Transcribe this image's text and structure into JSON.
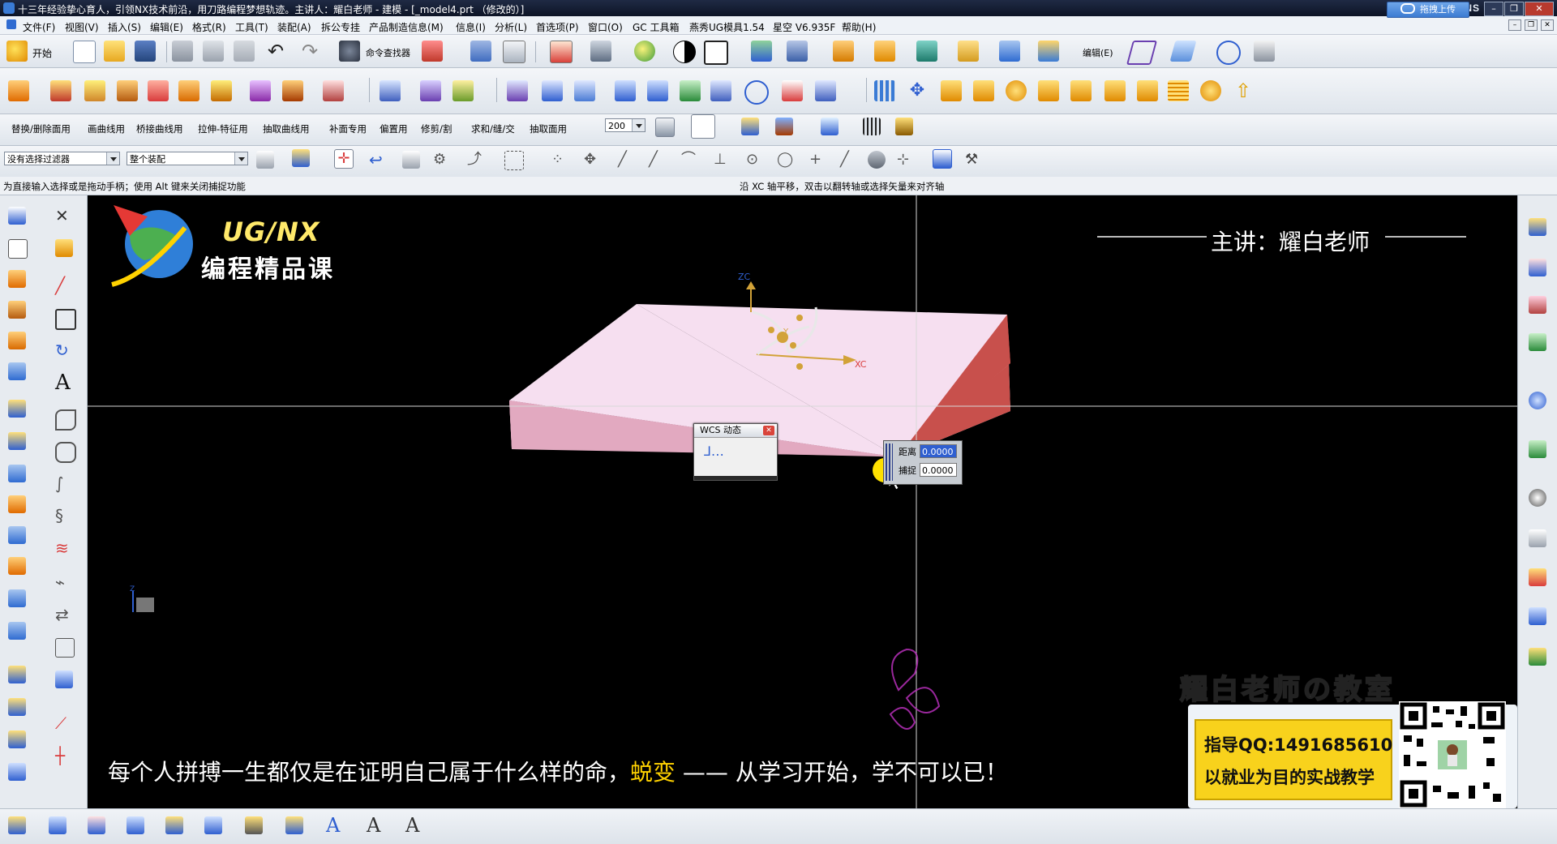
{
  "window": {
    "title": "十三年经验挚心育人，引领NX技术前沿，用刀路编程梦想轨迹。主讲人：耀白老师 - 建模 - [_model4.prt （修改的）]",
    "brand": "SIEMENS",
    "upload_label": "拖拽上传"
  },
  "menu": [
    "文件(F)",
    "视图(V)",
    "插入(S)",
    "编辑(E)",
    "格式(R)",
    "工具(T)",
    "装配(A)",
    "拆公专挂",
    "产品制造信息(M)",
    "信息(I)",
    "分析(L)",
    "首选项(P)",
    "窗口(O)",
    "GC 工具箱",
    "燕秀UG模具1.54",
    "星空 V6.935F",
    "帮助(H)"
  ],
  "toolbar1": {
    "start_label": "开始",
    "cmd_finder_label": "命令查找器",
    "edit_label": "编辑(E)"
  },
  "toolbar3": {
    "items": [
      "替换/删除面用",
      "画曲线用",
      "桥接曲线用",
      "拉伸-特征用",
      "抽取曲线用",
      "补面专用",
      "偏置用",
      "修剪/割",
      "求和/缝/交",
      "抽取面用"
    ],
    "zoom_value": "200"
  },
  "selectionbar": {
    "filter_value": "没有选择过滤器",
    "scope_value": "整个装配"
  },
  "status": {
    "left": "为直接输入选择或是拖动手柄；使用 Alt 键来关闭捕捉功能",
    "center": "沿 XC 轴平移，双击以翻转轴或选择矢量来对齐轴"
  },
  "viewport": {
    "brand_top": "UG/NX",
    "brand_bottom": "编程精品课",
    "teacher": "主讲：耀白老师",
    "axis_z": "ZC",
    "axis_x": "XC",
    "axis_y": "Y",
    "triad_z": "Z",
    "subtitle_a": "每个人拼搏一生都仅是在证明自己属于什么样的命，",
    "subtitle_hl": "蜕变",
    "subtitle_b": " —— 从学习开始，学不可以已！"
  },
  "wcs_dialog": {
    "title": "WCS 动态"
  },
  "dynamic_input": {
    "distance_label": "距离",
    "distance_value": "0.0000",
    "snap_label": "捕捉",
    "snap_value": "0.0000"
  },
  "promo": {
    "title": "耀白老师の教室",
    "line1": "指导QQ:1491685610",
    "line2": "以就业为目的实战教学"
  },
  "colors": {
    "block_top": "#f6dff0",
    "block_front": "#e6aec4",
    "block_side": "#c8504c",
    "accent_yellow": "#ffd200"
  }
}
